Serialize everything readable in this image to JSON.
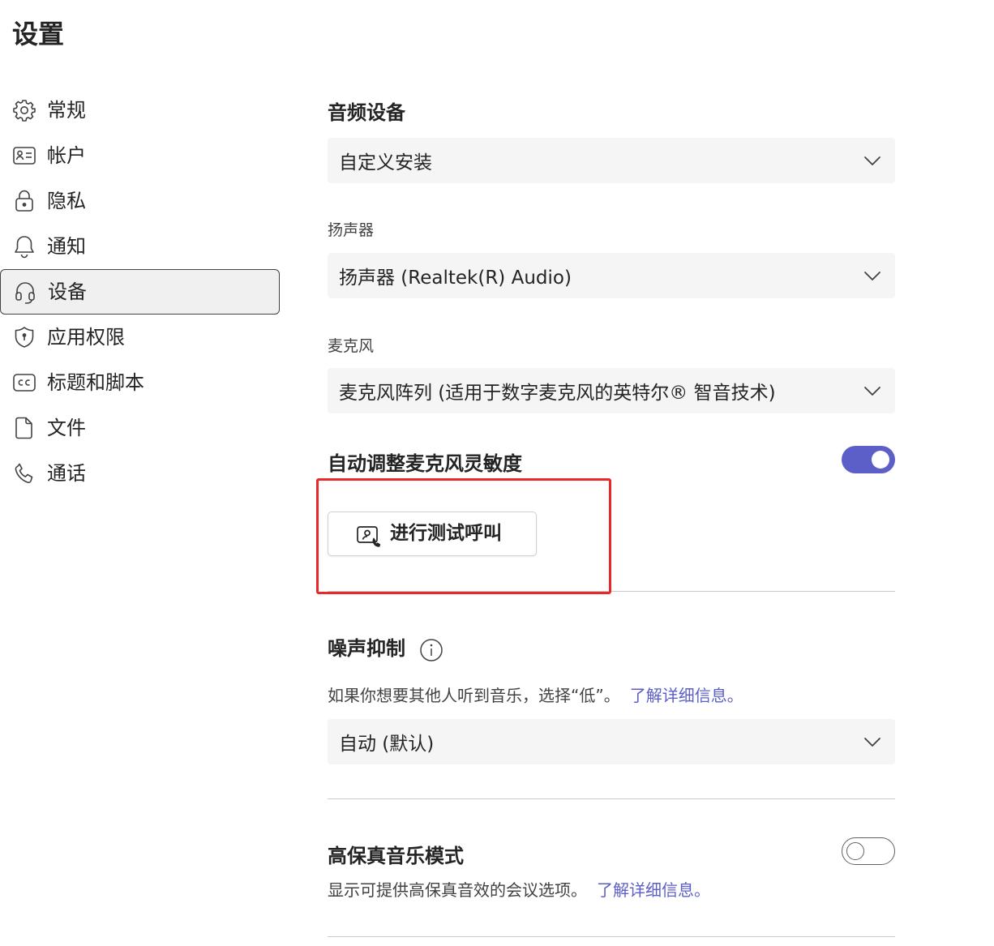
{
  "page": {
    "title": "设置"
  },
  "sidebar": {
    "items": [
      {
        "label": "常规",
        "icon": "gear-icon",
        "active": false
      },
      {
        "label": "帐户",
        "icon": "id-card-icon",
        "active": false
      },
      {
        "label": "隐私",
        "icon": "lock-icon",
        "active": false
      },
      {
        "label": "通知",
        "icon": "bell-icon",
        "active": false
      },
      {
        "label": "设备",
        "icon": "headset-icon",
        "active": true
      },
      {
        "label": "应用权限",
        "icon": "shield-icon",
        "active": false
      },
      {
        "label": "标题和脚本",
        "icon": "closed-caption-icon",
        "active": false
      },
      {
        "label": "文件",
        "icon": "file-icon",
        "active": false
      },
      {
        "label": "通话",
        "icon": "phone-icon",
        "active": false
      }
    ]
  },
  "devices": {
    "audio_heading": "音频设备",
    "audio_device_value": "自定义安装",
    "speaker_label": "扬声器",
    "speaker_value": "扬声器 (Realtek(R) Audio)",
    "mic_label": "麦克风",
    "mic_value": "麦克风阵列 (适用于数字麦克风的英特尔® 智音技术)",
    "auto_adjust_label": "自动调整麦克风灵敏度",
    "auto_adjust_on": true,
    "test_call_label": "进行测试呼叫",
    "noise_heading": "噪声抑制",
    "noise_desc": "如果你想要其他人听到音乐，选择“低”。",
    "noise_link": "了解详细信息。",
    "noise_value": "自动 (默认)",
    "hifi_heading": "高保真音乐模式",
    "hifi_on": false,
    "hifi_desc": "显示可提供高保真音效的会议选项。",
    "hifi_link": "了解详细信息。"
  },
  "colors": {
    "accent": "#5b5fc7",
    "highlight": "#e8282b",
    "dropdown_bg": "#f5f5f5"
  }
}
